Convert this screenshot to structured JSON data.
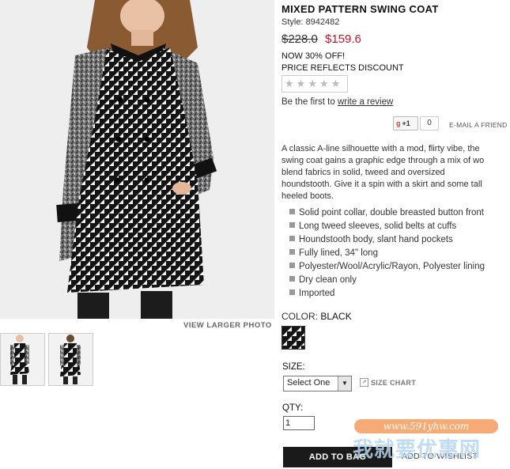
{
  "product": {
    "title": "MIXED PATTERN SWING COAT",
    "style": "Style: 8942482",
    "price_original": "$228.0",
    "price_sale": "$159.6",
    "promo_line1": "NOW 30% OFF!",
    "promo_line2": "PRICE REFLECTS DISCOUNT",
    "rating_stars": 0,
    "review_prefix": "Be the first to",
    "review_link": "write a review",
    "description_lines": [
      "A classic A-line silhouette with a mod, flirty vibe, the",
      "swing coat gains a graphic edge through a mix of wo",
      "blend fabrics in solid, tweed and oversized",
      "houndstooth. Give it a spin with a skirt and some tall",
      "heeled boots."
    ],
    "features": [
      "Solid point collar, double breasted button front",
      "Long tweed sleeves, solid belts at cuffs",
      "Houndstooth body, slant hand pockets",
      "Fully lined, 34\" long",
      "Polyester/Wool/Acrylic/Rayon, Polyester lining",
      "Dry clean only",
      "Imported"
    ]
  },
  "social": {
    "gplus_label": "+1",
    "gplus_count": "0",
    "email_friend": "E-MAIL A FRIEND"
  },
  "images": {
    "view_larger": "VIEW LARGER PHOTO"
  },
  "color": {
    "label": "COLOR:",
    "value": "BLACK"
  },
  "size": {
    "label": "SIZE:",
    "selected": "Select One",
    "size_chart": "SIZE CHART"
  },
  "qty": {
    "label": "QTY:",
    "value": "1"
  },
  "actions": {
    "add_to_bag": "ADD TO BAG",
    "add_to_wishlist": "ADD TO WISHLIST"
  },
  "watermark": {
    "url": "www.591yhw.com",
    "chinese": "我就要优惠网"
  },
  "colors": {
    "sale_price": "#c8102e",
    "button_bg": "#1a1a1a",
    "watermark_orange": "#f6a46c"
  }
}
